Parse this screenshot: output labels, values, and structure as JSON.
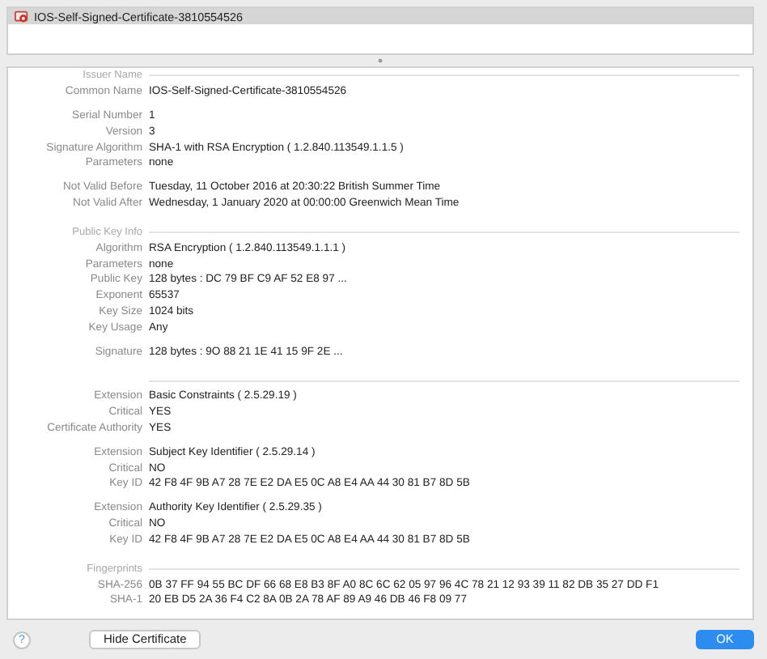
{
  "certificate_list": {
    "items": [
      {
        "name": "IOS-Self-Signed-Certificate-3810554526",
        "selected": true
      }
    ]
  },
  "details": {
    "sections": [
      {
        "header": "Issuer Name",
        "groups": [
          [
            {
              "label": "Common Name",
              "value": "IOS-Self-Signed-Certificate-3810554526"
            }
          ],
          [
            {
              "label": "Serial Number",
              "value": "1"
            },
            {
              "label": "Version",
              "value": "3"
            },
            {
              "label": "Signature Algorithm",
              "value": "SHA-1 with RSA Encryption ( 1.2.840.113549.1.1.5 )"
            },
            {
              "label": "Parameters",
              "value": "none"
            }
          ],
          [
            {
              "label": "Not Valid Before",
              "value": "Tuesday, 11 October 2016 at 20:30:22 British Summer Time"
            },
            {
              "label": "Not Valid After",
              "value": "Wednesday, 1 January 2020 at 00:00:00 Greenwich Mean Time"
            }
          ]
        ]
      },
      {
        "header": "Public Key Info",
        "groups": [
          [
            {
              "label": "Algorithm",
              "value": "RSA Encryption ( 1.2.840.113549.1.1.1 )"
            },
            {
              "label": "Parameters",
              "value": "none"
            },
            {
              "label": "Public Key",
              "value": "128 bytes : DC 79 BF C9 AF 52 E8 97 ..."
            },
            {
              "label": "Exponent",
              "value": "65537"
            },
            {
              "label": "Key Size",
              "value": "1024 bits"
            },
            {
              "label": "Key Usage",
              "value": "Any"
            }
          ],
          [
            {
              "label": "Signature",
              "value": "128 bytes : 9O 88 21 1E 41 15 9F 2E ..."
            }
          ]
        ]
      },
      {
        "groups": [
          [
            {
              "label": "Extension",
              "value": "Basic Constraints ( 2.5.29.19 )"
            },
            {
              "label": "Critical",
              "value": "YES"
            },
            {
              "label": "Certificate Authority",
              "value": "YES"
            }
          ],
          [
            {
              "label": "Extension",
              "value": "Subject Key Identifier ( 2.5.29.14 )"
            },
            {
              "label": "Critical",
              "value": "NO"
            },
            {
              "label": "Key ID",
              "value": "42 F8 4F 9B A7 28 7E E2 DA E5 0C A8 E4 AA 44 30 81 B7 8D 5B"
            }
          ],
          [
            {
              "label": "Extension",
              "value": "Authority Key Identifier ( 2.5.29.35 )"
            },
            {
              "label": "Critical",
              "value": "NO"
            },
            {
              "label": "Key ID",
              "value": "42 F8 4F 9B A7 28 7E E2 DA E5 0C A8 E4 AA 44 30 81 B7 8D 5B"
            }
          ]
        ]
      },
      {
        "header": "Fingerprints",
        "groups": [
          [
            {
              "label": "SHA-256",
              "value": "0B 37 FF 94 55 BC DF 66 68 E8 B3 8F A0 8C 6C 62 05 97 96 4C 78 21 12 93 39 11 82 DB 35 27 DD F1"
            },
            {
              "label": "SHA-1",
              "value": "20 EB D5 2A 36 F4 C2 8A 0B 2A 78 AF 89 A9 46 DB 46 F8 09 77"
            }
          ]
        ]
      }
    ]
  },
  "buttons": [
    {
      "kind": "help",
      "label": "?"
    },
    {
      "kind": "push",
      "label": "Hide Certificate",
      "default": false
    },
    {
      "kind": "push",
      "label": "OK",
      "default": true
    }
  ]
}
